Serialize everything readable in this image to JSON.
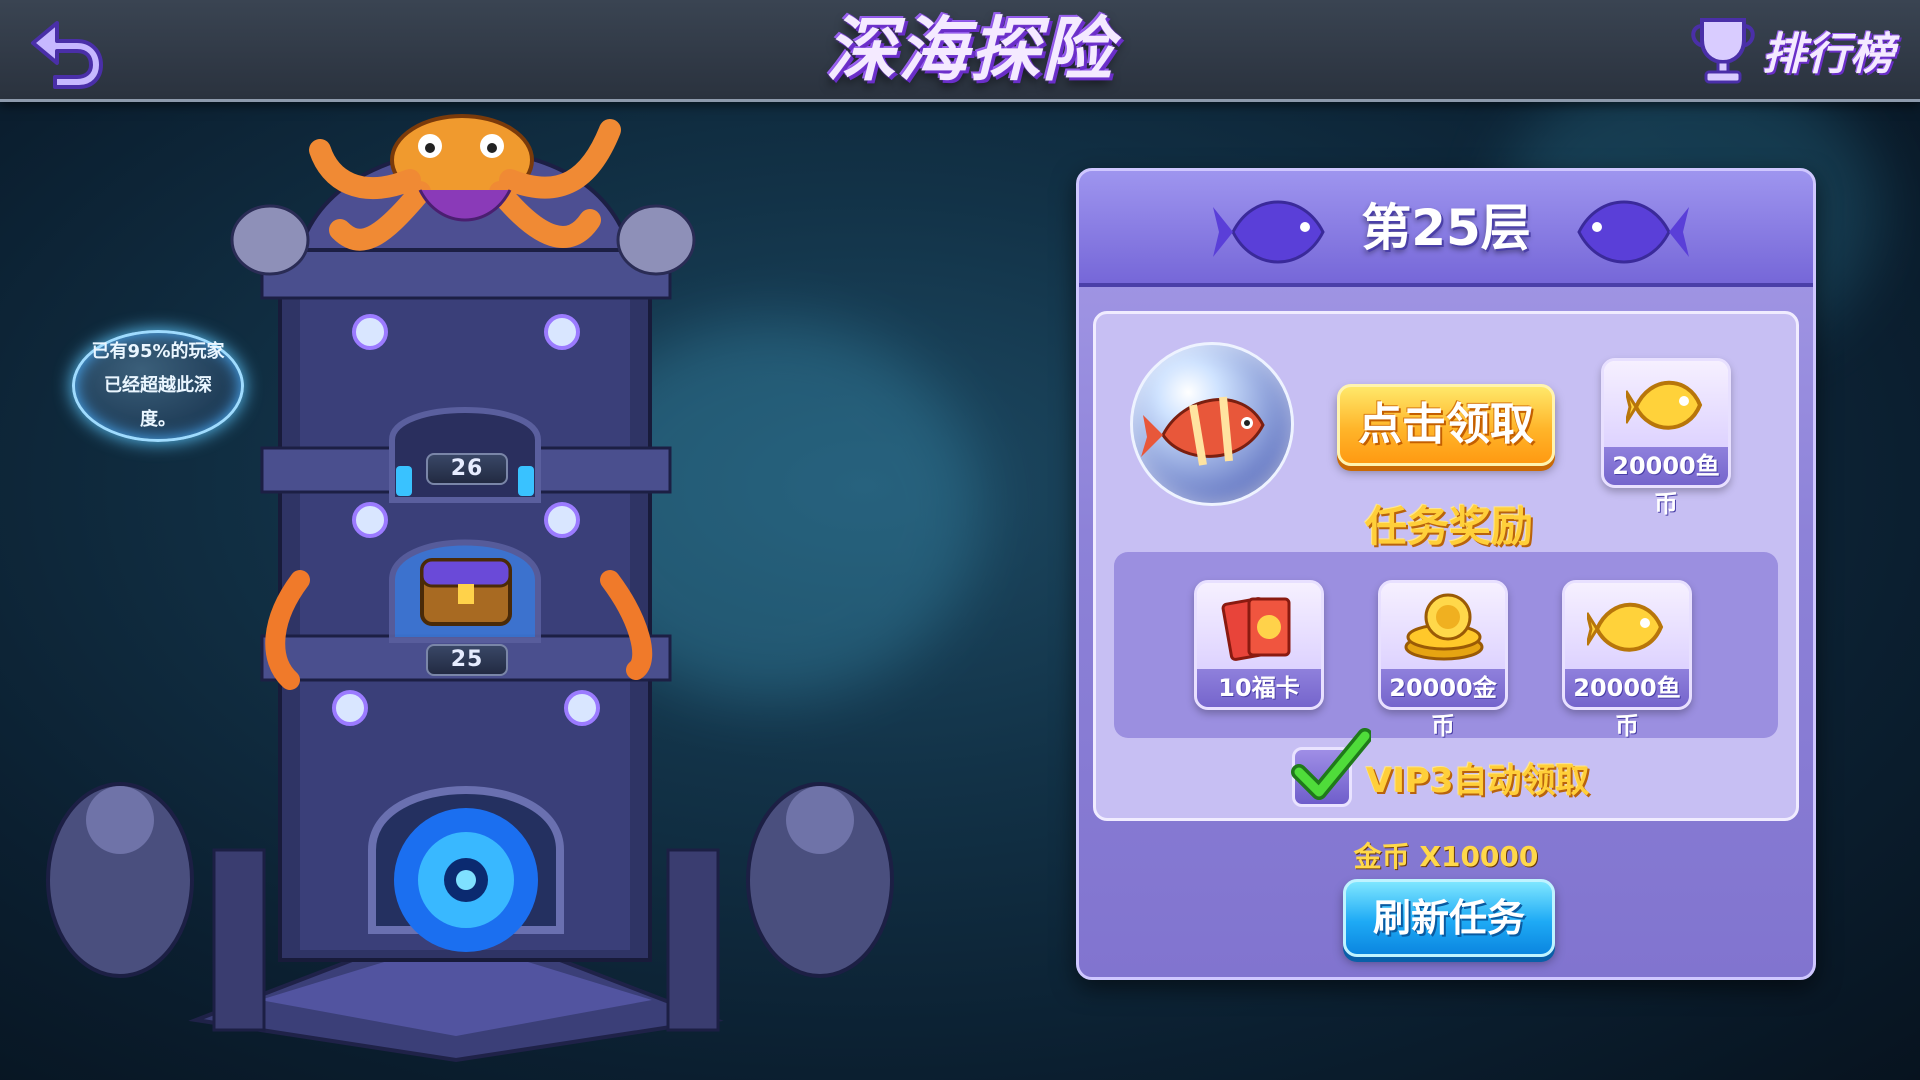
{
  "header": {
    "title": "深海探险",
    "leaderboard_label": "排行榜"
  },
  "tower": {
    "tip_text": "已有95%的玩家已经超越此深度。",
    "floors": [
      {
        "label": "26"
      },
      {
        "label": "25"
      }
    ]
  },
  "panel": {
    "floor_title": "第25层",
    "claim_button": "点击领取",
    "top_reward": {
      "label": "20000鱼币",
      "icon": "fish-coin-icon"
    },
    "task_reward_title": "任务奖励",
    "rewards": [
      {
        "label": "10福卡",
        "icon": "fortune-card-icon"
      },
      {
        "label": "20000金币",
        "icon": "gold-coin-icon"
      },
      {
        "label": "20000鱼币",
        "icon": "fish-coin-icon"
      }
    ],
    "vip_label": "VIP3自动领取",
    "vip_checked": true,
    "cost_text": "金币 X10000",
    "refresh_button": "刷新任务"
  },
  "colors": {
    "accent_gold": "#ffcf3a",
    "panel_purple": "#8d82d8",
    "refresh_blue": "#1eaaf5",
    "claim_orange": "#ffb52a"
  }
}
